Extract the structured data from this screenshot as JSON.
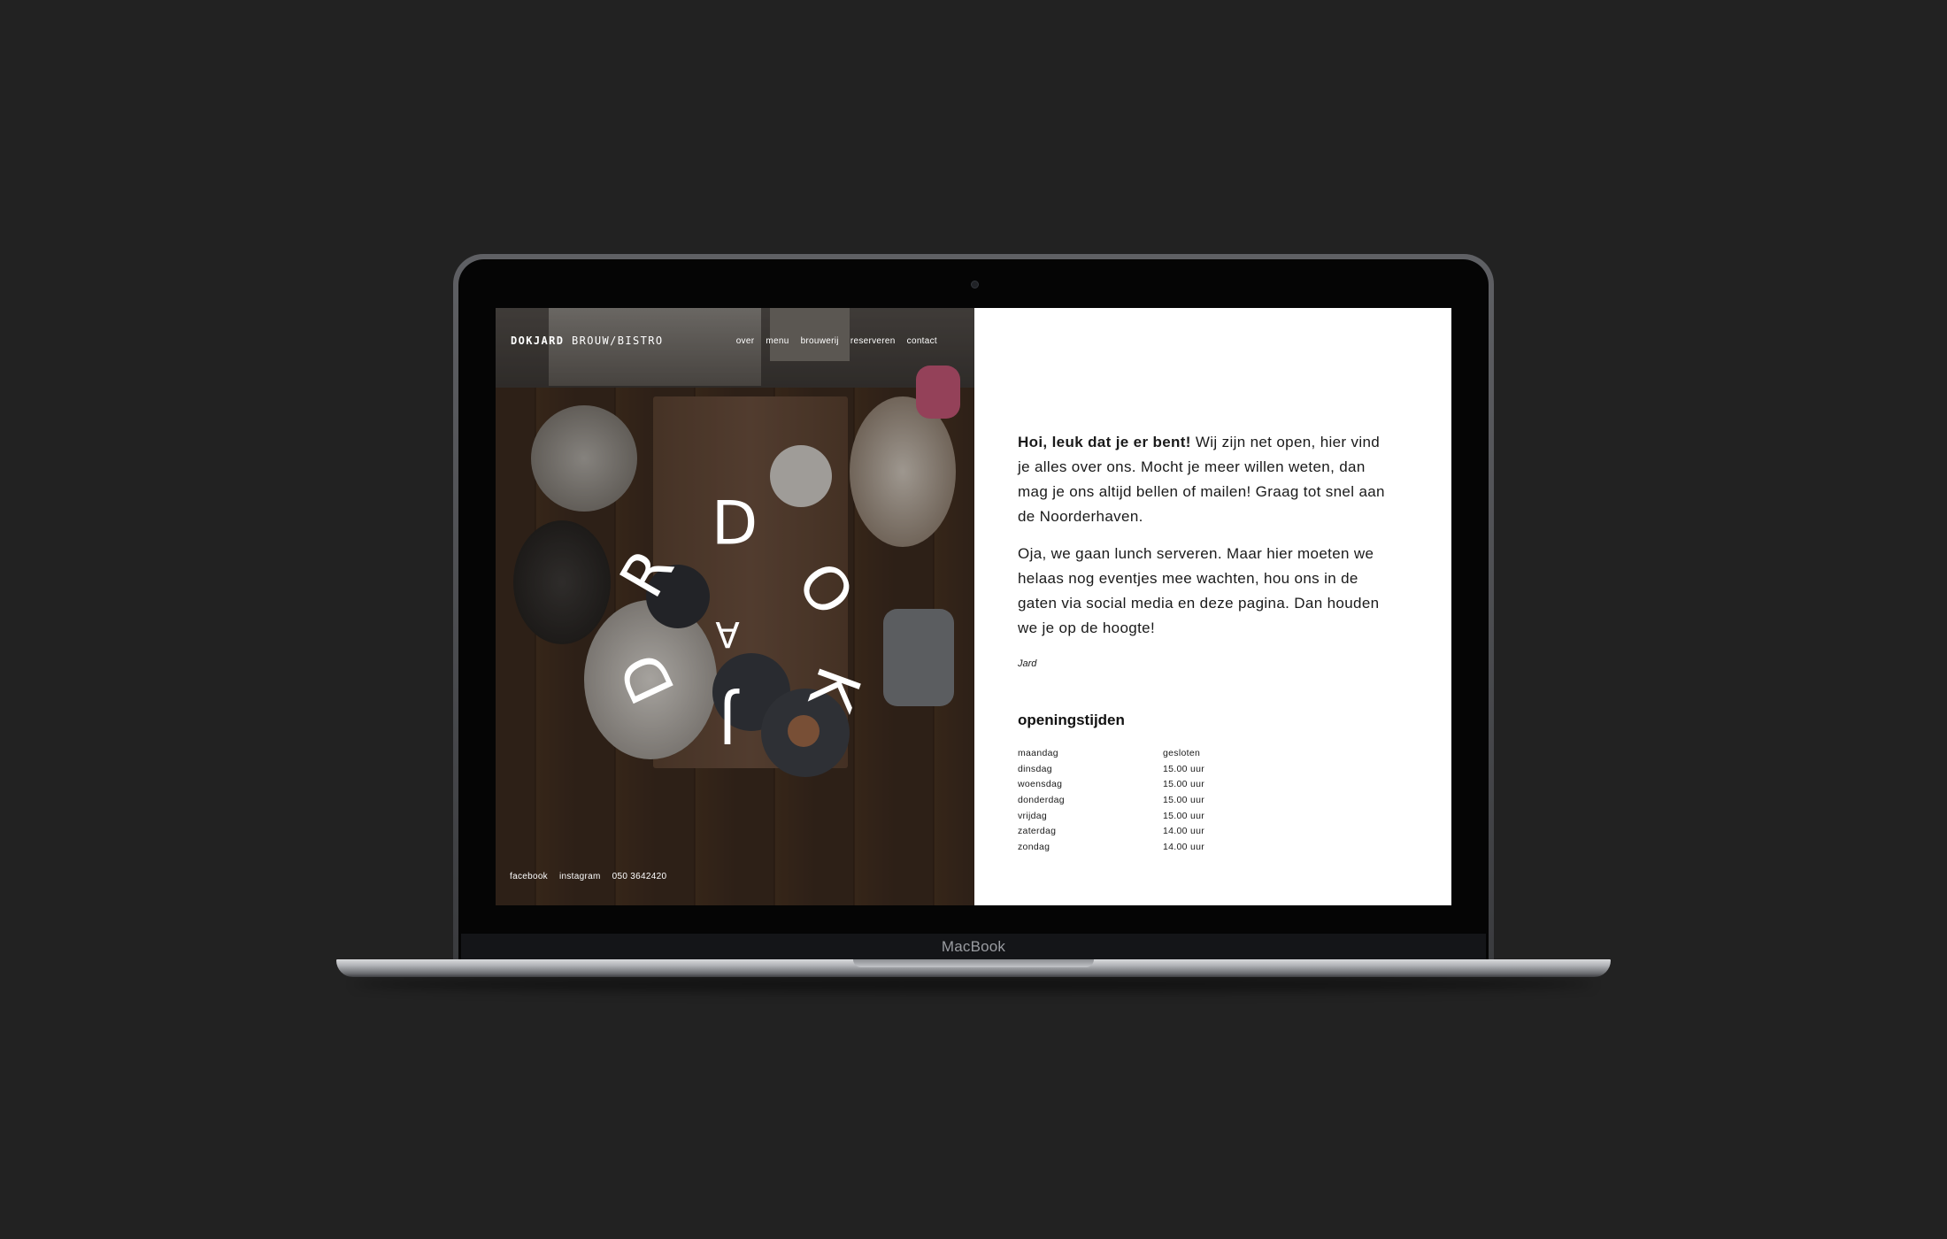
{
  "device": {
    "label": "MacBook"
  },
  "site": {
    "brand_bold": "DOKJARD",
    "brand_light": "BROUW/BISTRO",
    "nav": [
      "over",
      "menu",
      "brouwerij",
      "reserveren",
      "contact"
    ],
    "footer": [
      "facebook",
      "instagram",
      "050 3642420"
    ],
    "logo_letters": [
      "D",
      "O",
      "K",
      "J",
      "A",
      "R",
      "D"
    ]
  },
  "content": {
    "intro_bold": "Hoi, leuk dat je er bent!",
    "intro_rest": " Wij zijn net open, hier vind je alles over ons. Mocht je meer willen weten, dan mag je ons altijd bellen of mailen! Graag tot snel aan de Noorderhaven.",
    "paragraph2": "Oja, we gaan lunch serveren. Maar hier moeten we helaas nog eventjes mee wachten, hou ons in de gaten via social media en deze pagina. Dan houden we je op de hoogte!",
    "signature": "Jard",
    "hours_title": "openingstijden",
    "hours": [
      {
        "day": "maandag",
        "time": "gesloten"
      },
      {
        "day": "dinsdag",
        "time": "15.00 uur"
      },
      {
        "day": "woensdag",
        "time": "15.00 uur"
      },
      {
        "day": "donderdag",
        "time": "15.00 uur"
      },
      {
        "day": "vrijdag",
        "time": "15.00 uur"
      },
      {
        "day": "zaterdag",
        "time": "14.00 uur"
      },
      {
        "day": "zondag",
        "time": "14.00 uur"
      }
    ]
  },
  "colors": {
    "background": "#222222",
    "screen_right": "#ffffff",
    "text": "#1a1a1a"
  }
}
